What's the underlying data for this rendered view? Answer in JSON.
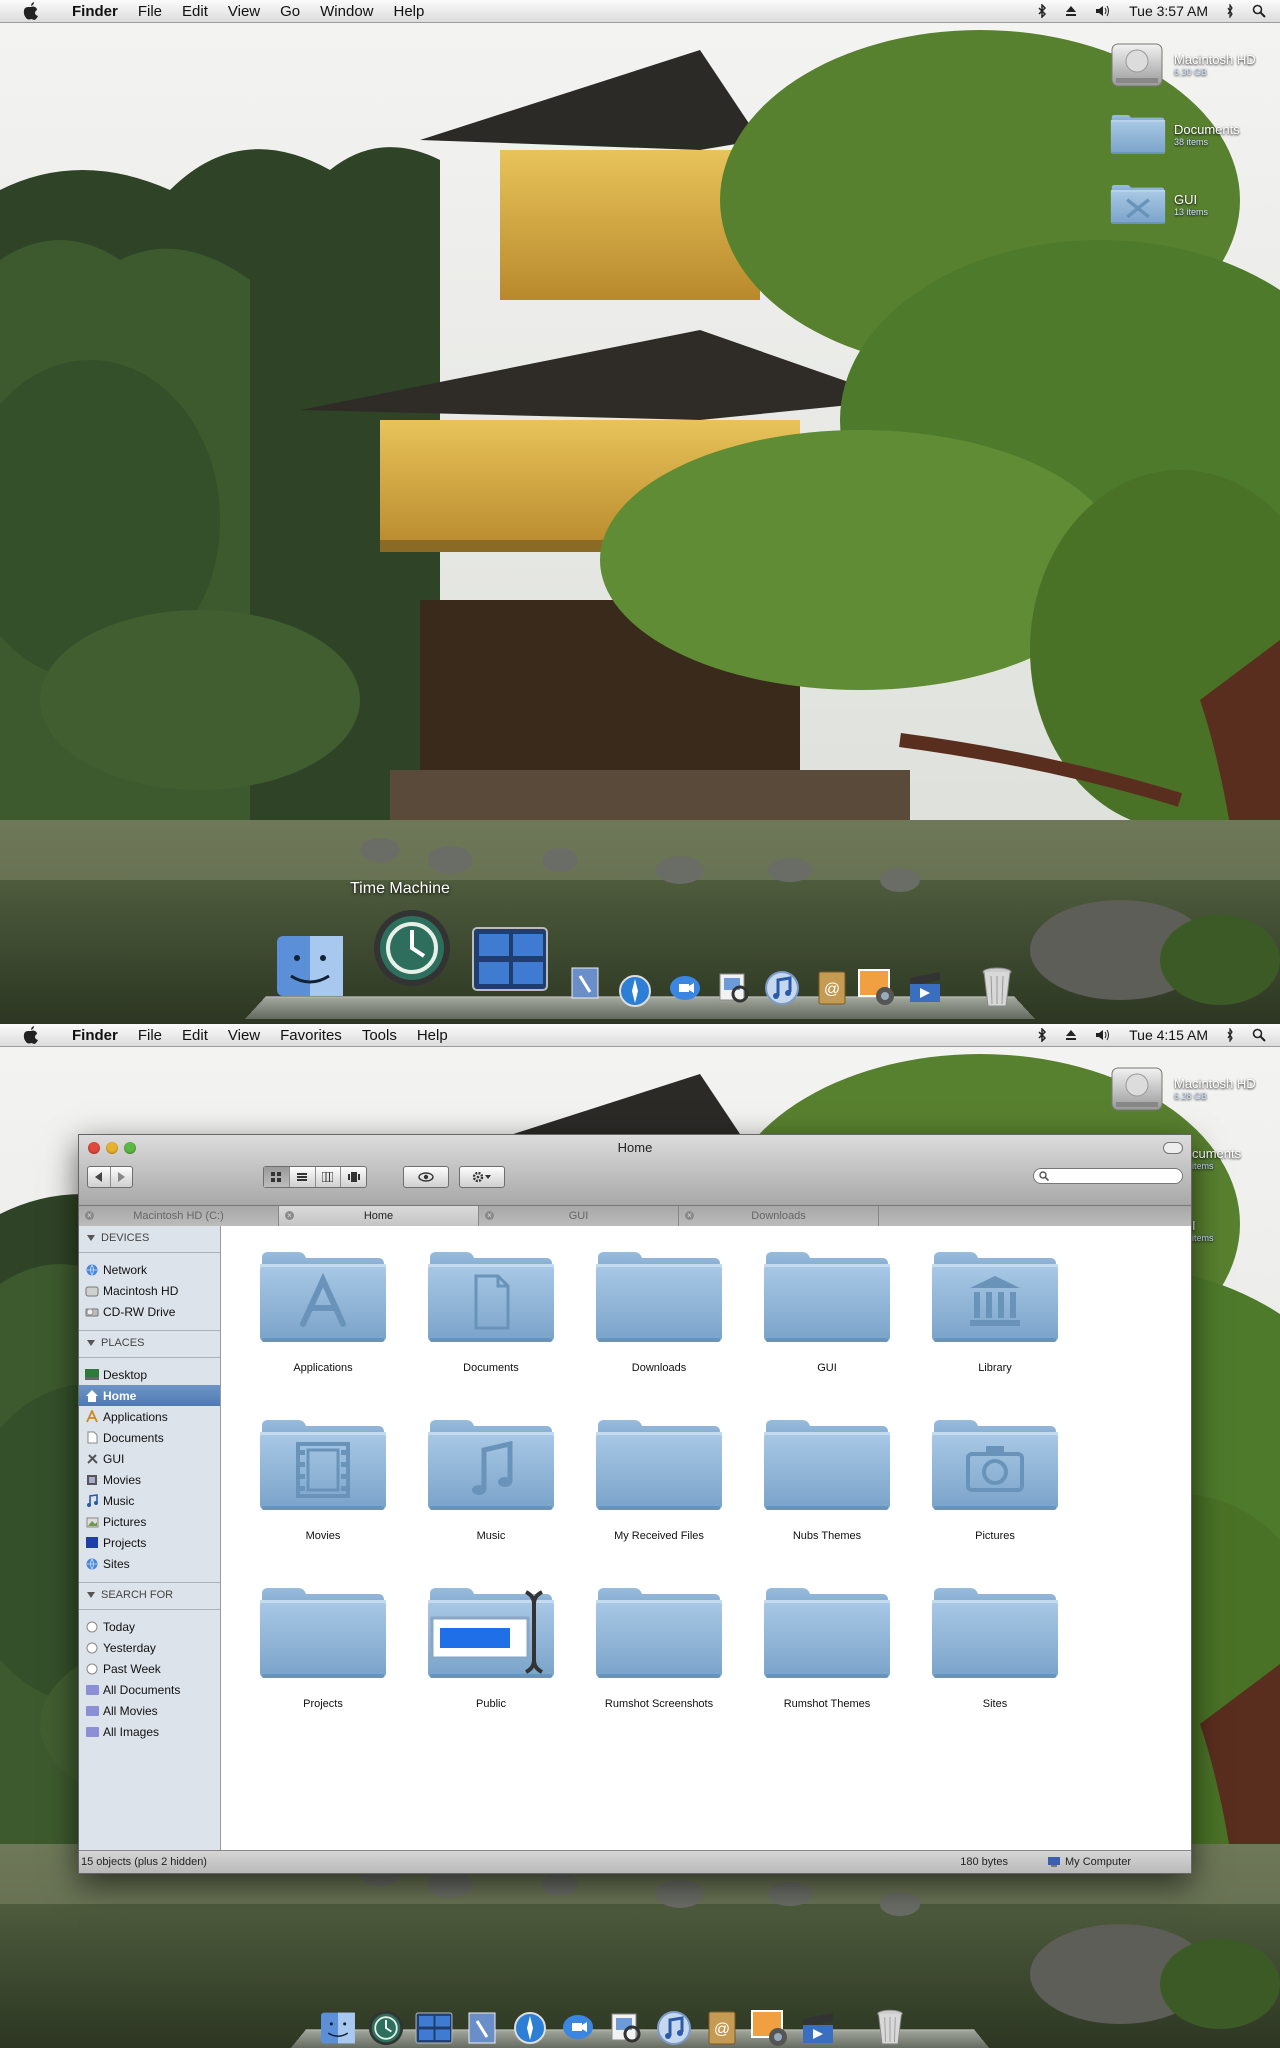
{
  "screens": [
    {
      "menubar": {
        "items": [
          "Finder",
          "File",
          "Edit",
          "View",
          "Go",
          "Window",
          "Help"
        ],
        "clock": "Tue 3:57 AM"
      },
      "desktop_icons": [
        {
          "name": "Macintosh HD",
          "sub": "6.30 GB"
        },
        {
          "name": "Documents",
          "sub": "38 items"
        },
        {
          "name": "GUI",
          "sub": "13 items"
        }
      ],
      "dock": {
        "hover_label": "Time Machine",
        "apps": [
          "finder-icon",
          "time-machine-icon",
          "spaces-icon",
          "mail-icon",
          "safari-icon",
          "ichat-icon",
          "preview-icon",
          "itunes-icon",
          "address-book-icon",
          "iphoto-icon",
          "imovie-icon",
          "trash-icon"
        ]
      }
    },
    {
      "menubar": {
        "items": [
          "Finder",
          "File",
          "Edit",
          "View",
          "Favorites",
          "Tools",
          "Help"
        ],
        "clock": "Tue 4:15 AM"
      },
      "desktop_icons": [
        {
          "name": "Macintosh HD",
          "sub": "6.28 GB"
        },
        {
          "name": "cuments",
          "sub": "items"
        },
        {
          "name": "I",
          "sub": "items"
        }
      ]
    }
  ],
  "finder": {
    "title": "Home",
    "search_placeholder": "",
    "tabs": [
      {
        "label": "Macintosh HD (C:)",
        "active": false
      },
      {
        "label": "Home",
        "active": true
      },
      {
        "label": "GUI",
        "active": false
      },
      {
        "label": "Downloads",
        "active": false
      }
    ],
    "sidebar": {
      "devices_header": "DEVICES",
      "devices": [
        "Network",
        "Macintosh HD",
        "CD-RW Drive"
      ],
      "places_header": "PLACES",
      "places": [
        "Desktop",
        "Home",
        "Applications",
        "Documents",
        "GUI",
        "Movies",
        "Music",
        "Pictures",
        "Projects",
        "Sites"
      ],
      "search_header": "SEARCH FOR",
      "search": [
        "Today",
        "Yesterday",
        "Past Week",
        "All Documents",
        "All Movies",
        "All Images"
      ]
    },
    "items": [
      {
        "label": "Applications",
        "emblem": "applications"
      },
      {
        "label": "Documents",
        "emblem": "document"
      },
      {
        "label": "Downloads",
        "emblem": "none"
      },
      {
        "label": "GUI",
        "emblem": "none"
      },
      {
        "label": "Library",
        "emblem": "library"
      },
      {
        "label": "Movies",
        "emblem": "film"
      },
      {
        "label": "Music",
        "emblem": "music"
      },
      {
        "label": "My Received Files",
        "emblem": "none"
      },
      {
        "label": "Nubs Themes",
        "emblem": "none"
      },
      {
        "label": "Pictures",
        "emblem": "camera"
      },
      {
        "label": "Projects",
        "emblem": "none"
      },
      {
        "label": "Public",
        "emblem": "public"
      },
      {
        "label": "Rumshot Screenshots",
        "emblem": "none"
      },
      {
        "label": "Rumshot Themes",
        "emblem": "none"
      },
      {
        "label": "Sites",
        "emblem": "none"
      }
    ],
    "status": {
      "objects": "15 objects (plus 2 hidden)",
      "size": "180 bytes",
      "location": "My Computer"
    }
  },
  "colors": {
    "folder": "#8fb6d8",
    "selection": "#5a82b8",
    "menubar": "#ececec"
  }
}
